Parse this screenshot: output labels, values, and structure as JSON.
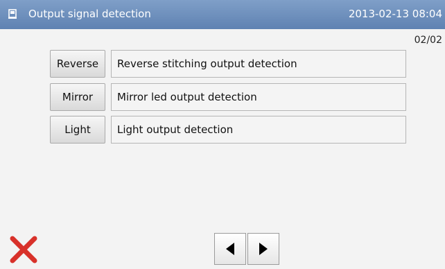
{
  "header": {
    "title": "Output signal detection",
    "datetime": "2013-02-13  08:04",
    "icon": "panel-icon"
  },
  "page_indicator": "02/02",
  "rows": [
    {
      "button": "Reverse",
      "description": "Reverse stitching output detection"
    },
    {
      "button": "Mirror",
      "description": "Mirror led output detection"
    },
    {
      "button": "Light",
      "description": "Light output detection"
    }
  ],
  "footer": {
    "close_icon": "close-icon",
    "prev_icon": "arrow-left-icon",
    "next_icon": "arrow-right-icon",
    "close_color": "#d8312a"
  }
}
